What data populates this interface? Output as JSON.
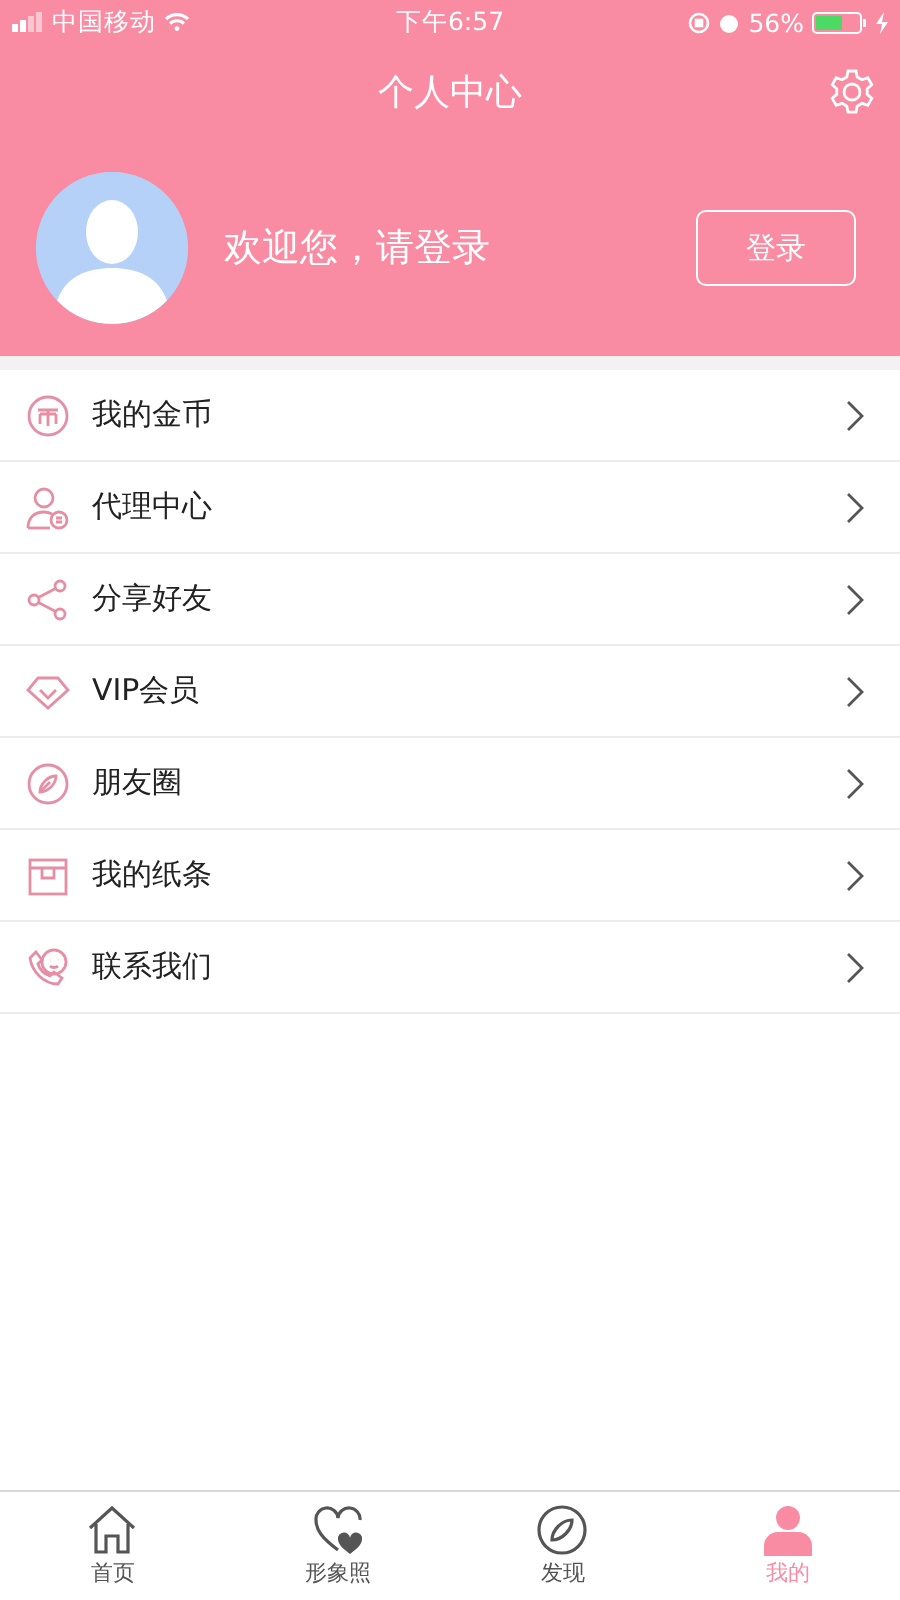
{
  "status_bar": {
    "carrier": "中国移动",
    "time": "下午6:57",
    "battery": "56%"
  },
  "header": {
    "title": "个人中心"
  },
  "profile": {
    "greeting": "欢迎您，请登录",
    "login_button": "登录"
  },
  "menu": [
    {
      "kind": "coin",
      "label": "我的金币"
    },
    {
      "kind": "agent",
      "label": "代理中心"
    },
    {
      "kind": "share",
      "label": "分享好友"
    },
    {
      "kind": "vip",
      "label": "VIP会员"
    },
    {
      "kind": "moments",
      "label": "朋友圈"
    },
    {
      "kind": "note",
      "label": "我的纸条"
    },
    {
      "kind": "contact",
      "label": "联系我们"
    }
  ],
  "tabs": [
    {
      "kind": "home",
      "label": "首页",
      "selected": false
    },
    {
      "kind": "heart",
      "label": "形象照",
      "selected": false
    },
    {
      "kind": "compass",
      "label": "发现",
      "selected": false
    },
    {
      "kind": "person",
      "label": "我的",
      "selected": true
    }
  ]
}
